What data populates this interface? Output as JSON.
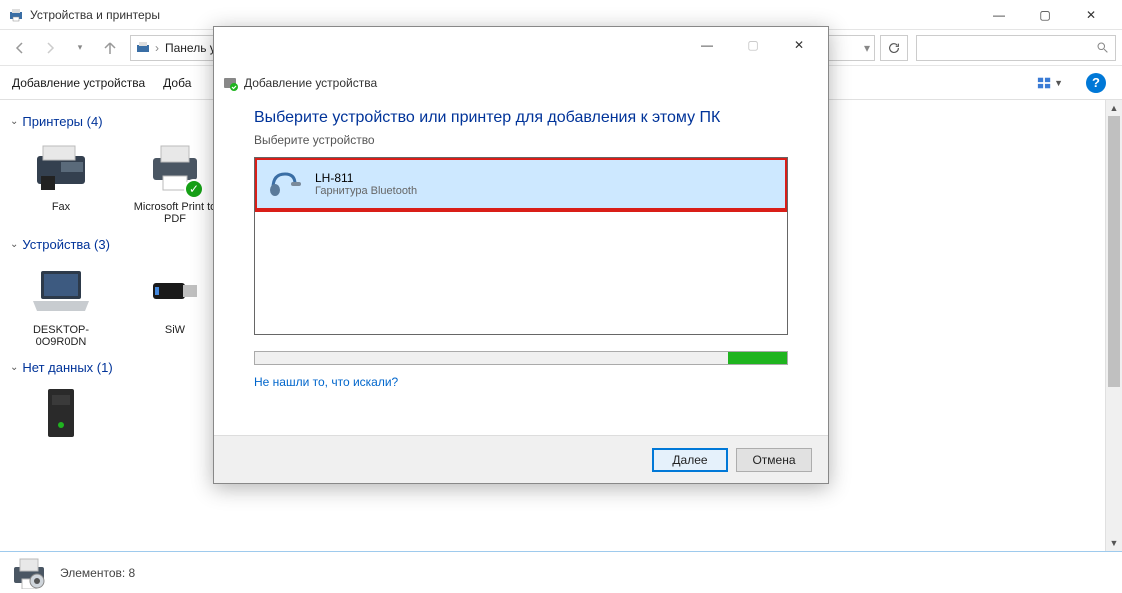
{
  "window": {
    "title": "Устройства и принтеры",
    "min": "—",
    "max": "▢",
    "close": "✕"
  },
  "breadcrumb": {
    "root_sep": "›",
    "item1": "Панель упр",
    "dropdown_chev": "▾"
  },
  "search": {
    "placeholder": ""
  },
  "toolbar": {
    "add_device": "Добавление устройства",
    "doba_prefix": "Доба"
  },
  "groups": [
    {
      "label": "Принтеры (4)"
    },
    {
      "label": "Устройства (3)"
    },
    {
      "label": "Нет данных (1)"
    }
  ],
  "devices": {
    "printers": [
      {
        "name": "Fax"
      },
      {
        "name": "Microsoft Print to PDF",
        "default": true
      }
    ],
    "devices": [
      {
        "name": "DESKTOP-0O9R0DN"
      },
      {
        "name": "SiW"
      }
    ],
    "nodata": [
      {
        "name": ""
      }
    ]
  },
  "status": {
    "label": "Элементов: 8"
  },
  "modal": {
    "title": "Добавление устройства",
    "heading": "Выберите устройство или принтер для добавления к этому ПК",
    "subtitle": "Выберите устройство",
    "device_name": "LH-811",
    "device_type": "Гарнитура Bluetooth",
    "not_found_link": "Не нашли то, что искали?",
    "next": "Далее",
    "cancel": "Отмена",
    "min": "—",
    "max": "▢",
    "close": "✕"
  }
}
